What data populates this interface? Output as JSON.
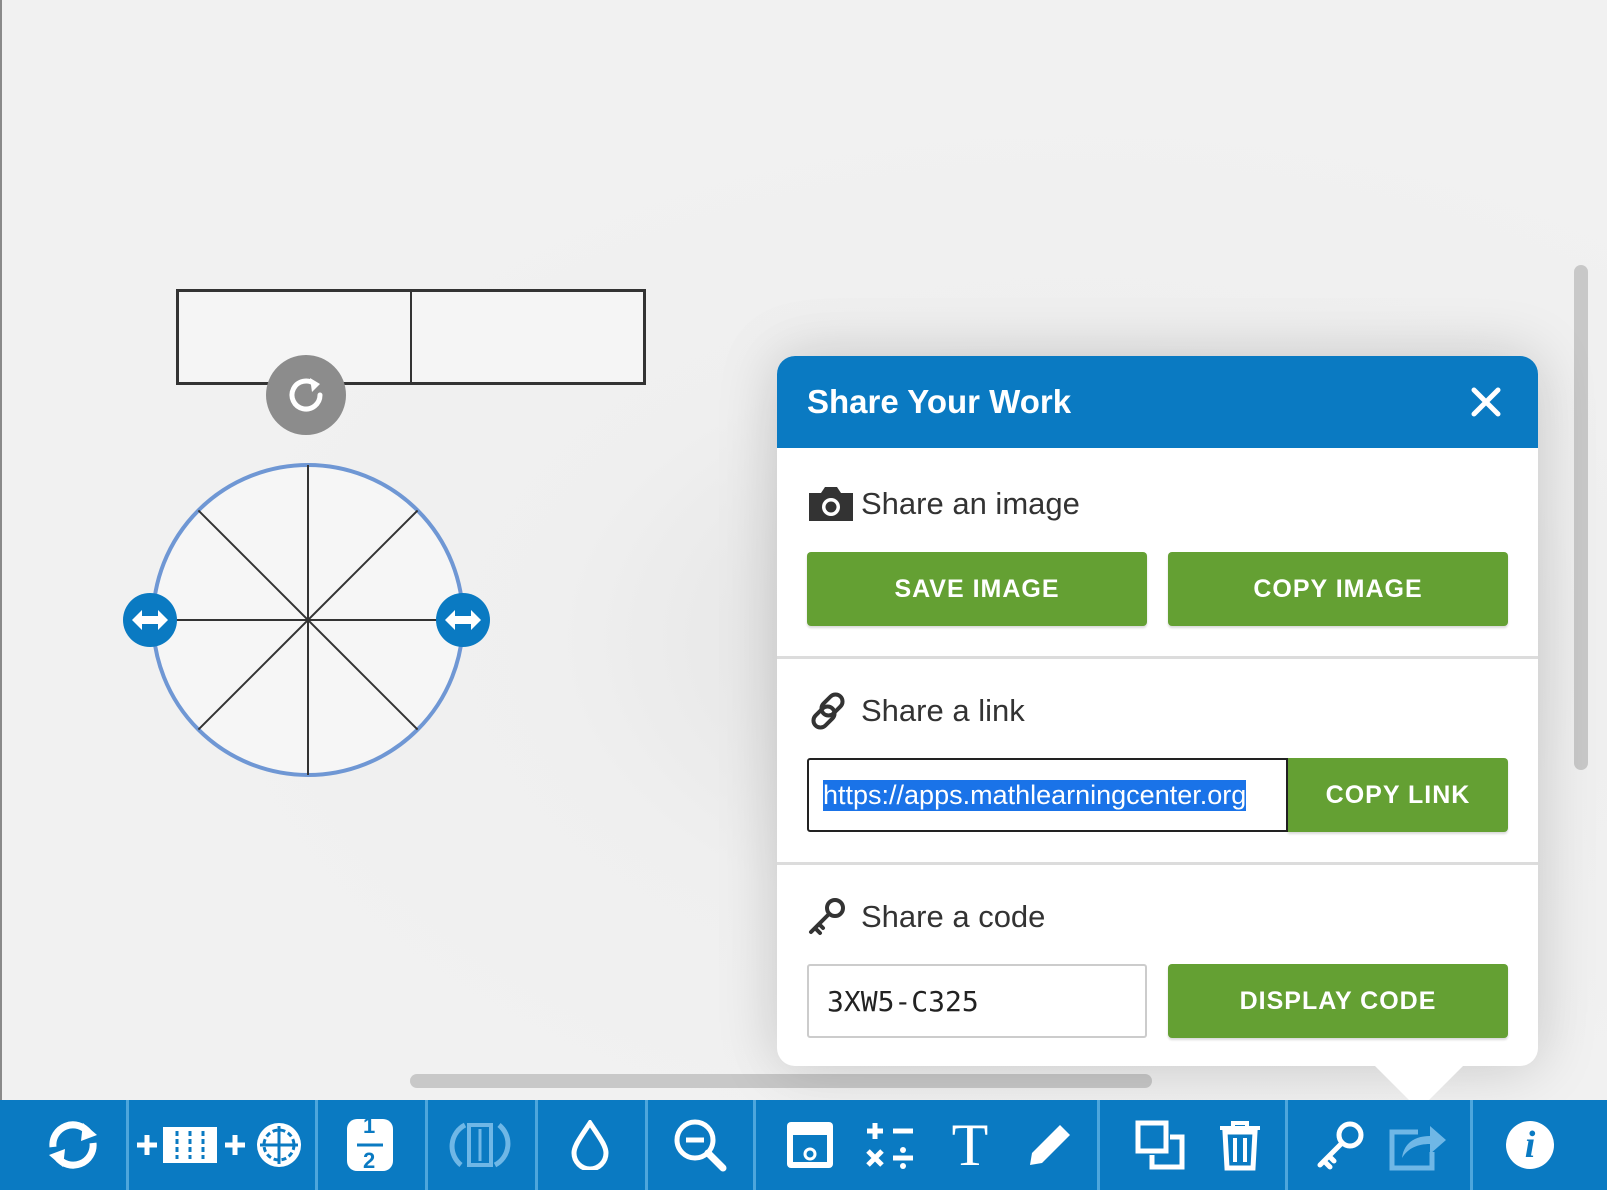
{
  "dialog": {
    "title": "Share Your Work",
    "image_section": {
      "label": "Share an image",
      "save_button": "SAVE IMAGE",
      "copy_button": "COPY IMAGE",
      "icon": "camera-icon"
    },
    "link_section": {
      "label": "Share a link",
      "url": "https://apps.mathlearningcenter.org",
      "copy_button": "COPY LINK",
      "icon": "link-icon"
    },
    "code_section": {
      "label": "Share a code",
      "code": "3XW5-C325",
      "display_button": "DISPLAY CODE",
      "icon": "key-icon"
    }
  },
  "canvas": {
    "fraction_bar_parts": 2,
    "fraction_circle_parts": 8
  },
  "toolbar": {
    "icons": [
      "refresh-icon",
      "add-bar-icon",
      "add-circle-icon",
      "fraction-label-icon",
      "flip-icon",
      "color-drop-icon",
      "zoom-out-icon",
      "cover-icon",
      "operations-icon",
      "text-icon",
      "pen-icon",
      "duplicate-icon",
      "trash-icon",
      "key-icon",
      "share-icon",
      "info-icon"
    ],
    "fraction_glyph_num": "1",
    "fraction_glyph_den": "2",
    "text_glyph": "T",
    "info_glyph": "i"
  },
  "colors": {
    "brand_blue": "#0a7ac2",
    "button_green": "#64a033",
    "circle_outline": "#6f97d4"
  }
}
